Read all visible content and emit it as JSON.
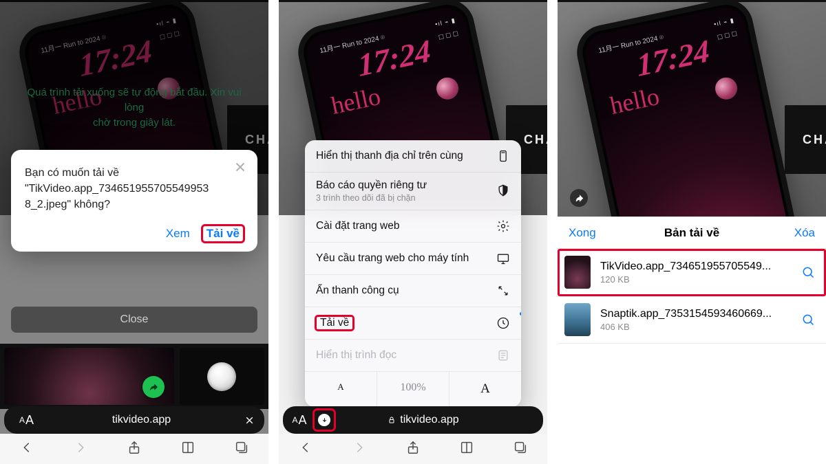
{
  "panel1": {
    "banner_line1": "Quá trình tải xuống sẽ tự động bắt đầu. Xin vui lòng",
    "banner_line2": "chờ trong giây lát.",
    "alert_line1": "Bạn có muốn tải về",
    "alert_line2": "\"TikVideo.app_734651955705549953",
    "alert_line3": "8_2.jpeg\" không?",
    "view": "Xem",
    "download": "Tải về",
    "close": "Close",
    "host": "tikvideo.app"
  },
  "panel2": {
    "menu": {
      "addr_top": "Hiển thị thanh địa chỉ trên cùng",
      "privacy": "Báo cáo quyền riêng tư",
      "privacy_sub": "3 trình theo dõi đã bị chặn",
      "settings": "Cài đặt trang web",
      "desktop": "Yêu cầu trang web cho máy tính",
      "hide_toolbar": "Ẩn thanh công cụ",
      "downloads": "Tải về",
      "reader": "Hiển thị trình đọc",
      "zoom": "100%"
    },
    "host": "tikvideo.app"
  },
  "panel3": {
    "done": "Xong",
    "title": "Bản tải về",
    "clear": "Xóa",
    "item1": {
      "name": "TikVideo.app_734651955705549...",
      "size": "120 KB"
    },
    "item2": {
      "name": "Snaptik.app_7353154593460669...",
      "size": "406 KB"
    }
  },
  "product": {
    "date": "11月一  Run to 2024 ⌾",
    "time": "17:24",
    "hello": "hello",
    "cha": "CHA"
  }
}
